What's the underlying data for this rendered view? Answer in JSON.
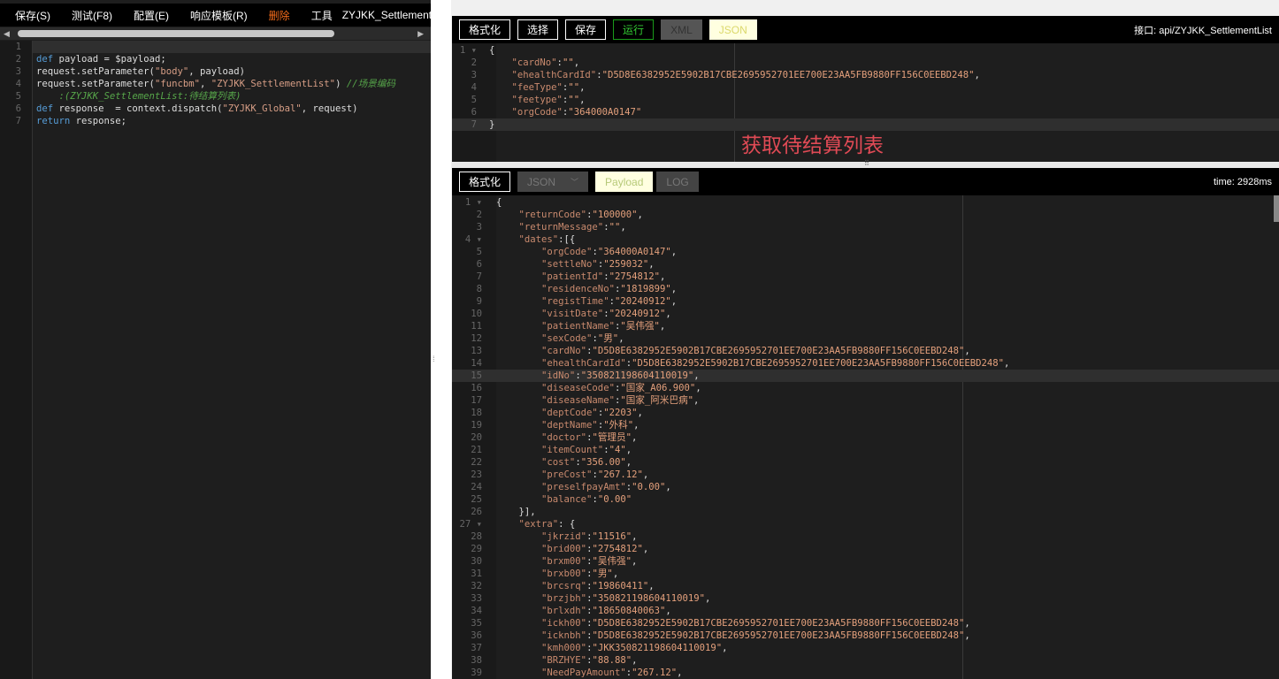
{
  "left_menu": {
    "items": [
      "保存(S)",
      "测试(F8)",
      "配置(E)",
      "响应模板(R)",
      "删除",
      "工具"
    ],
    "title": "ZYJKK_SettlementList"
  },
  "script_lines": [
    "",
    "def payload = $payload;",
    "request.setParameter(\"body\", payload)",
    "request.setParameter(\"funcbm\", \"ZYJKK_SettlementList\") //场景编码",
    "    :(ZYJKK_SettlementList:待结算列表)",
    "def response  = context.dispatch(\"ZYJKK_Global\", request)",
    "return response;",
    ""
  ],
  "script_line_numbers": [
    "1",
    "2",
    "3",
    "4",
    "",
    "5",
    "6",
    "7"
  ],
  "request_toolbar": {
    "format": "格式化",
    "select": "选择",
    "save": "保存",
    "run": "运行",
    "xml": "XML",
    "json": "JSON",
    "api_label": "接口: api/ZYJKK_SettlementList"
  },
  "request_lines": [
    "{",
    "    \"cardNo\":\"\",",
    "    \"ehealthCardId\":\"D5D8E6382952E5902B17CBE2695952701EE700E23AA5FB9880FF156C0EEBD248\",",
    "    \"feeType\":\"\",",
    "    \"feetype\":\"\",",
    "    \"orgCode\":\"364000A0147\"",
    "}"
  ],
  "request_description": "获取待结算列表",
  "response_toolbar": {
    "format": "格式化",
    "json_select": "JSON",
    "payload": "Payload",
    "log": "LOG",
    "time": "time: 2928ms"
  },
  "response_lines": [
    "{",
    "    \"returnCode\":\"100000\",",
    "    \"returnMessage\":\"\",",
    "    \"dates\":[{",
    "        \"orgCode\":\"364000A0147\",",
    "        \"settleNo\":\"259032\",",
    "        \"patientId\":\"2754812\",",
    "        \"residenceNo\":\"1819899\",",
    "        \"registTime\":\"20240912\",",
    "        \"visitDate\":\"20240912\",",
    "        \"patientName\":\"吴伟强\",",
    "        \"sexCode\":\"男\",",
    "        \"cardNo\":\"D5D8E6382952E5902B17CBE2695952701EE700E23AA5FB9880FF156C0EEBD248\",",
    "        \"ehealthCardId\":\"D5D8E6382952E5902B17CBE2695952701EE700E23AA5FB9880FF156C0EEBD248\",",
    "        \"idNo\":\"350821198604110019\",",
    "        \"diseaseCode\":\"国家_A06.900\",",
    "        \"diseaseName\":\"国家_阿米巴病\",",
    "        \"deptCode\":\"2203\",",
    "        \"deptName\":\"外科\",",
    "        \"doctor\":\"管理员\",",
    "        \"itemCount\":\"4\",",
    "        \"cost\":\"356.00\",",
    "        \"preCost\":\"267.12\",",
    "        \"preselfpayAmt\":\"0.00\",",
    "        \"balance\":\"0.00\"",
    "    }],",
    "    \"extra\": {",
    "        \"jkrzid\":\"11516\",",
    "        \"brid00\":\"2754812\",",
    "        \"brxm00\":\"吴伟强\",",
    "        \"brxb00\":\"男\",",
    "        \"brcsrq\":\"19860411\",",
    "        \"brzjbh\":\"350821198604110019\",",
    "        \"brlxdh\":\"18650840063\",",
    "        \"ickh00\":\"D5D8E6382952E5902B17CBE2695952701EE700E23AA5FB9880FF156C0EEBD248\",",
    "        \"icknbh\":\"D5D8E6382952E5902B17CBE2695952701EE700E23AA5FB9880FF156C0EEBD248\",",
    "        \"kmh000\":\"JKK350821198604110019\",",
    "        \"BRZHYE\":\"88.88\",",
    "        \"NeedPayAmount\":\"267.12\","
  ]
}
